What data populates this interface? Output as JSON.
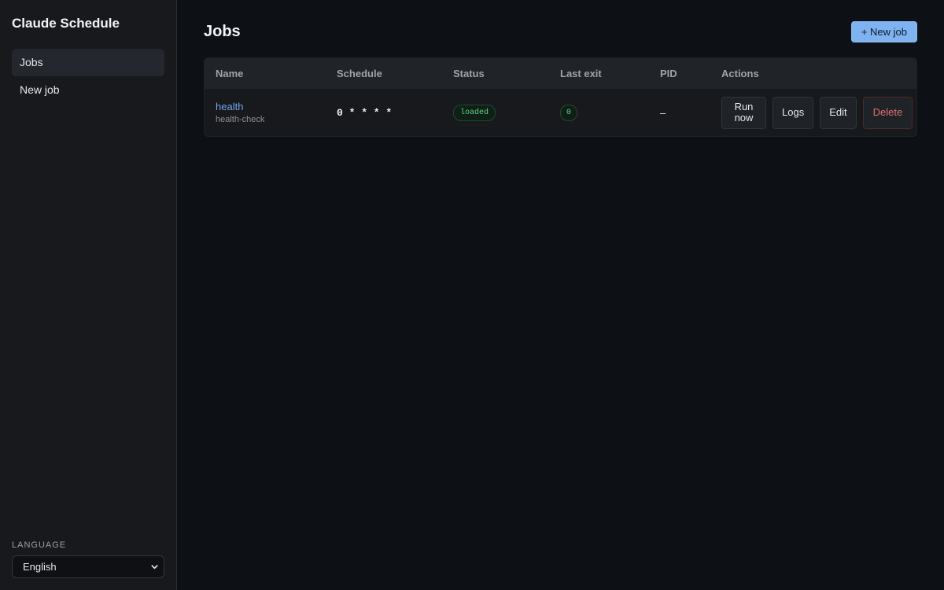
{
  "sidebar": {
    "brand": "Claude Schedule",
    "nav": [
      {
        "label": "Jobs",
        "active": true
      },
      {
        "label": "New job",
        "active": false
      }
    ],
    "language_label": "LANGUAGE",
    "language_value": "English"
  },
  "header": {
    "title": "Jobs",
    "new_job_label": "+ New job"
  },
  "table": {
    "columns": [
      "Name",
      "Schedule",
      "Status",
      "Last exit",
      "PID",
      "Actions"
    ],
    "rows": [
      {
        "name": "health",
        "id": "health-check",
        "schedule": "0 * * * *",
        "status": "loaded",
        "last_exit": "0",
        "pid": "–",
        "actions": {
          "run": "Run now",
          "logs": "Logs",
          "edit": "Edit",
          "delete": "Delete"
        }
      }
    ]
  },
  "colors": {
    "accent": "#7fb2f0",
    "status_ok": "#5fd38a",
    "danger": "#e07070",
    "link": "#6ea8e8"
  }
}
